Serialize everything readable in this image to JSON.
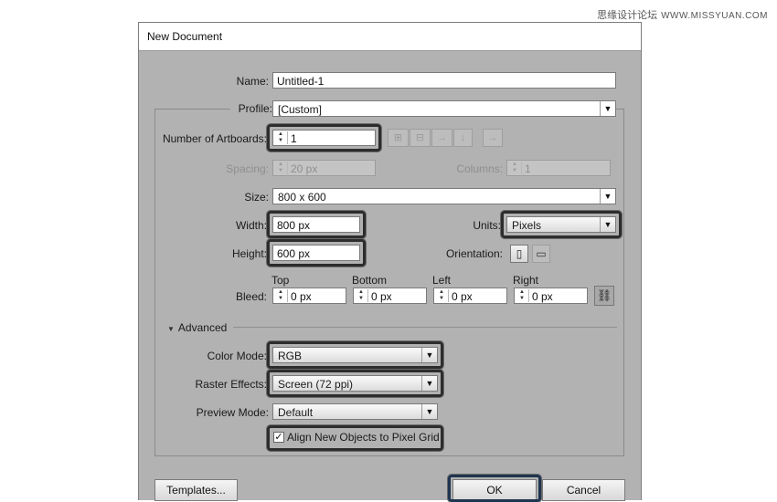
{
  "watermark": {
    "cn": "思缘设计论坛",
    "site": "WWW.MISSYUAN.COM"
  },
  "dialog": {
    "title": "New Document",
    "name": {
      "label": "Name:",
      "value": "Untitled-1"
    },
    "profile": {
      "label": "Profile:",
      "value": "[Custom]"
    },
    "artboards": {
      "label": "Number of Artboards:",
      "value": "1"
    },
    "spacing": {
      "label": "Spacing:",
      "value": "20 px"
    },
    "columns": {
      "label": "Columns:",
      "value": "1"
    },
    "size": {
      "label": "Size:",
      "value": "800 x 600"
    },
    "width": {
      "label": "Width:",
      "value": "800 px"
    },
    "units": {
      "label": "Units:",
      "value": "Pixels"
    },
    "height": {
      "label": "Height:",
      "value": "600 px"
    },
    "orientation": {
      "label": "Orientation:"
    },
    "bleed": {
      "label": "Bleed:",
      "top": {
        "label": "Top",
        "value": "0 px"
      },
      "bottom": {
        "label": "Bottom",
        "value": "0 px"
      },
      "left": {
        "label": "Left",
        "value": "0 px"
      },
      "right": {
        "label": "Right",
        "value": "0 px"
      }
    },
    "advanced": {
      "label": "Advanced"
    },
    "color_mode": {
      "label": "Color Mode:",
      "value": "RGB"
    },
    "raster_effects": {
      "label": "Raster Effects:",
      "value": "Screen (72 ppi)"
    },
    "preview_mode": {
      "label": "Preview Mode:",
      "value": "Default"
    },
    "align_pixel_grid": {
      "label": "Align New Objects to Pixel Grid",
      "checked": true
    },
    "buttons": {
      "templates": "Templates...",
      "ok": "OK",
      "cancel": "Cancel"
    }
  }
}
